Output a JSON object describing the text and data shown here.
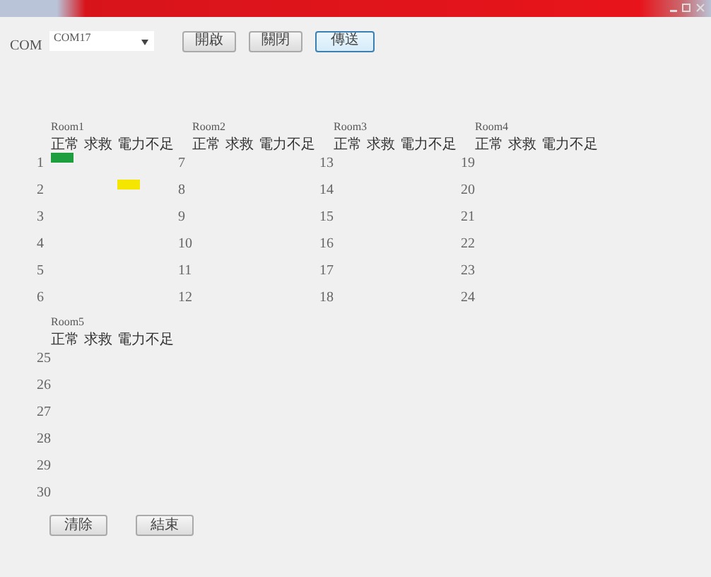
{
  "toolbar": {
    "label": "COM",
    "port": {
      "value": "COM17"
    },
    "buttons": [
      {
        "label": "開啟",
        "focused": false
      },
      {
        "label": "關閉",
        "focused": false
      },
      {
        "label": "傳送",
        "focused": true
      }
    ]
  },
  "rooms": [
    {
      "name": "Room1",
      "columns": [
        "正常",
        "求救",
        "電力不足"
      ],
      "slots": [
        {
          "number": "1",
          "normal": true,
          "rescue": false,
          "low_power": false
        },
        {
          "number": "2",
          "normal": false,
          "rescue": false,
          "low_power": true
        },
        {
          "number": "3",
          "normal": false,
          "rescue": false,
          "low_power": false
        },
        {
          "number": "4",
          "normal": false,
          "rescue": false,
          "low_power": false
        },
        {
          "number": "5",
          "normal": false,
          "rescue": false,
          "low_power": false
        },
        {
          "number": "6",
          "normal": false,
          "rescue": false,
          "low_power": false
        }
      ]
    },
    {
      "name": "Room2",
      "columns": [
        "正常",
        "求救",
        "電力不足"
      ],
      "slots": [
        {
          "number": "7",
          "normal": false,
          "rescue": false,
          "low_power": false
        },
        {
          "number": "8",
          "normal": false,
          "rescue": false,
          "low_power": false
        },
        {
          "number": "9",
          "normal": false,
          "rescue": false,
          "low_power": false
        },
        {
          "number": "10",
          "normal": false,
          "rescue": false,
          "low_power": false
        },
        {
          "number": "11",
          "normal": false,
          "rescue": false,
          "low_power": false
        },
        {
          "number": "12",
          "normal": false,
          "rescue": false,
          "low_power": false
        }
      ]
    },
    {
      "name": "Room3",
      "columns": [
        "正常",
        "求救",
        "電力不足"
      ],
      "slots": [
        {
          "number": "13",
          "normal": false,
          "rescue": false,
          "low_power": false
        },
        {
          "number": "14",
          "normal": false,
          "rescue": false,
          "low_power": false
        },
        {
          "number": "15",
          "normal": false,
          "rescue": false,
          "low_power": false
        },
        {
          "number": "16",
          "normal": false,
          "rescue": false,
          "low_power": false
        },
        {
          "number": "17",
          "normal": false,
          "rescue": false,
          "low_power": false
        },
        {
          "number": "18",
          "normal": false,
          "rescue": false,
          "low_power": false
        }
      ]
    },
    {
      "name": "Room4",
      "columns": [
        "正常",
        "求救",
        "電力不足"
      ],
      "slots": [
        {
          "number": "19",
          "normal": false,
          "rescue": false,
          "low_power": false
        },
        {
          "number": "20",
          "normal": false,
          "rescue": false,
          "low_power": false
        },
        {
          "number": "21",
          "normal": false,
          "rescue": false,
          "low_power": false
        },
        {
          "number": "22",
          "normal": false,
          "rescue": false,
          "low_power": false
        },
        {
          "number": "23",
          "normal": false,
          "rescue": false,
          "low_power": false
        },
        {
          "number": "24",
          "normal": false,
          "rescue": false,
          "low_power": false
        }
      ]
    },
    {
      "name": "Room5",
      "columns": [
        "正常",
        "求救",
        "電力不足"
      ],
      "slots": [
        {
          "number": "25",
          "normal": false,
          "rescue": false,
          "low_power": false
        },
        {
          "number": "26",
          "normal": false,
          "rescue": false,
          "low_power": false
        },
        {
          "number": "27",
          "normal": false,
          "rescue": false,
          "low_power": false
        },
        {
          "number": "28",
          "normal": false,
          "rescue": false,
          "low_power": false
        },
        {
          "number": "29",
          "normal": false,
          "rescue": false,
          "low_power": false
        },
        {
          "number": "30",
          "normal": false,
          "rescue": false,
          "low_power": false
        }
      ]
    }
  ],
  "footer_buttons": [
    "清除",
    "結束"
  ]
}
